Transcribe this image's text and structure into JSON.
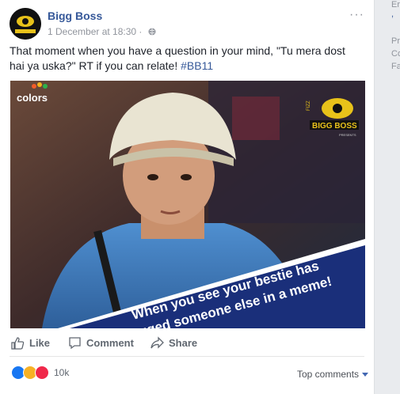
{
  "post": {
    "page_name": "Bigg Boss",
    "timestamp": "1 December at 18:30",
    "privacy_icon": "globe-icon",
    "more_icon": "ellipsis-icon",
    "more_text": "···",
    "text_main": "That moment when you have a question in your mind, \"Tu mera dost hai ya uska?\" RT if you can relate! ",
    "hashtag": "#BB11",
    "image": {
      "channel_logo": "colors",
      "channel_logo_sub": "COLORS",
      "show_logo": "BIGG BOSS",
      "show_logo_prefix": "FIZZ",
      "show_logo_sub": "PRESENTS",
      "caption_line1": "When you see your bestie has",
      "caption_line2": "tagged someone else in a meme!"
    },
    "actions": {
      "like": "Like",
      "comment": "Comment",
      "share": "Share"
    },
    "reactions": {
      "types": [
        "like",
        "haha",
        "love"
      ],
      "count": "10k"
    },
    "top_comments": "Top comments"
  },
  "sidebar": {
    "line1": "Er",
    "line2": ", ",
    "line3": "Pr",
    "line4": "Co",
    "line5": "Fa"
  },
  "colors": {
    "link_blue": "#365899",
    "like_blue": "#1877f2",
    "text": "#1d2129",
    "muted": "#90949c"
  }
}
